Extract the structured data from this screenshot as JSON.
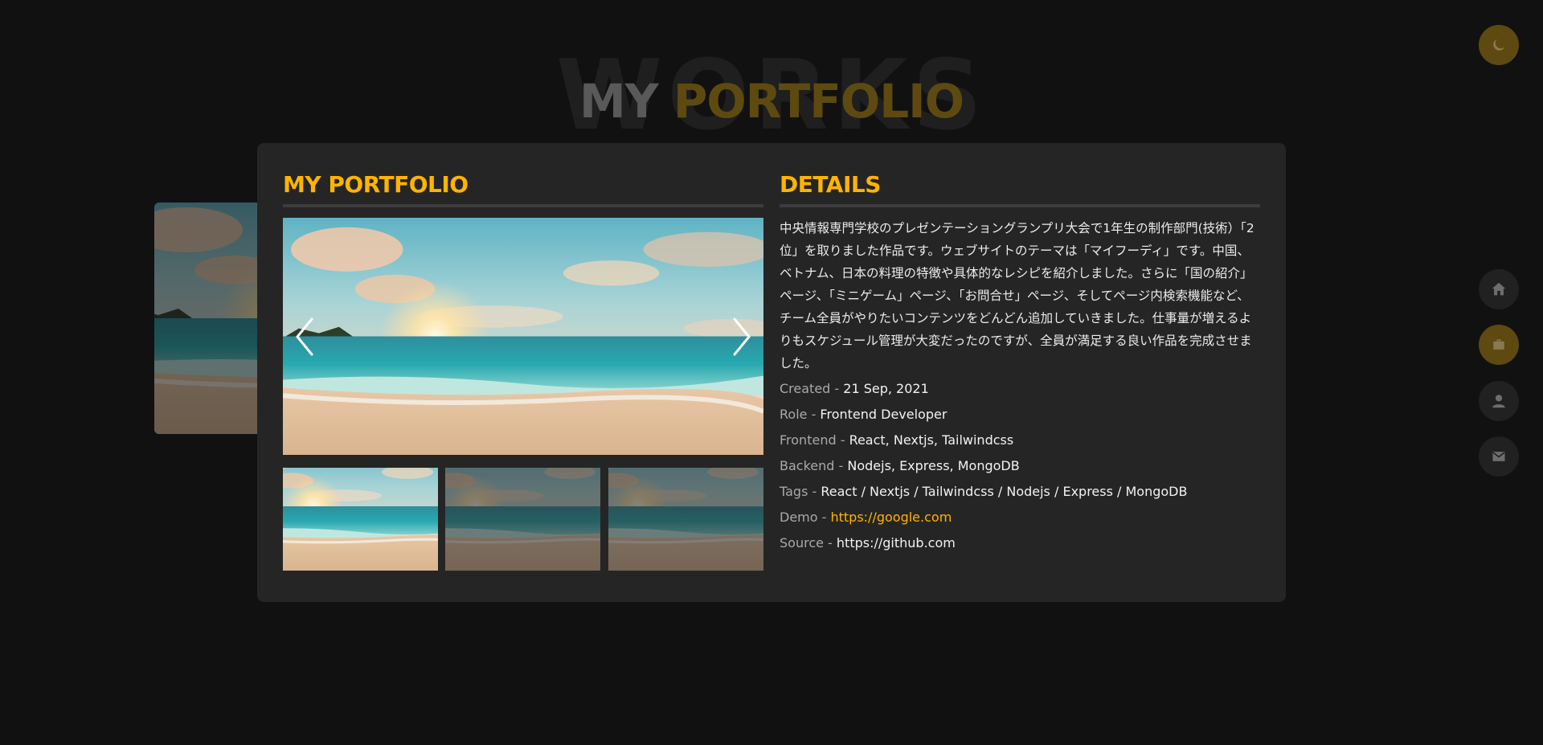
{
  "background_word": "WORKS",
  "headline": {
    "word1": "MY",
    "word2": "PORTFOLIO"
  },
  "modal": {
    "left_title": "MY PORTFOLIO",
    "right_title": "DETAILS",
    "description": "中央情報専門学校のプレゼンテーショングランプリ大会で1年生の制作部門(技術）「2位」を取りました作品です。ウェブサイトのテーマは「マイフーディ」です。中国、ベトナム、日本の料理の特徴や具体的なレシピを紹介しました。さらに「国の紹介」ページ、「ミニゲーム」ページ、「お問合せ」ページ、そしてページ内検索機能など、チーム全員がやりたいコンテンツをどんどん追加していきました。仕事量が増えるよりもスケジュール管理が大変だったのですが、全員が満足する良い作品を完成させました。",
    "details": {
      "created": {
        "label": "Created - ",
        "value": "21 Sep, 2021"
      },
      "role": {
        "label": "Role - ",
        "value": "Frontend Developer"
      },
      "frontend": {
        "label": "Frontend - ",
        "value": "React, Nextjs, Tailwindcss"
      },
      "backend": {
        "label": "Backend - ",
        "value": "Nodejs, Express, MongoDB"
      },
      "tags": {
        "label": "Tags - ",
        "value": "React / Nextjs / Tailwindcss / Nodejs / Express / MongoDB"
      },
      "demo": {
        "label": "Demo - ",
        "value": "https://google.com"
      },
      "source": {
        "label": "Source - ",
        "value": "https://github.com"
      }
    },
    "slider": {
      "image": "beach-sunset-photo",
      "thumbnails_count": 3,
      "active_thumbnail": 1
    }
  },
  "nav": {
    "theme_icon": "moon-icon",
    "items": [
      {
        "icon": "home-icon",
        "active": false
      },
      {
        "icon": "briefcase-icon",
        "active": true
      },
      {
        "icon": "user-icon",
        "active": false
      },
      {
        "icon": "mail-icon",
        "active": false
      }
    ]
  },
  "colors": {
    "accent": "#ffb400",
    "accent_dim": "#5e4a10",
    "background": "#111111",
    "panel": "#252525"
  }
}
